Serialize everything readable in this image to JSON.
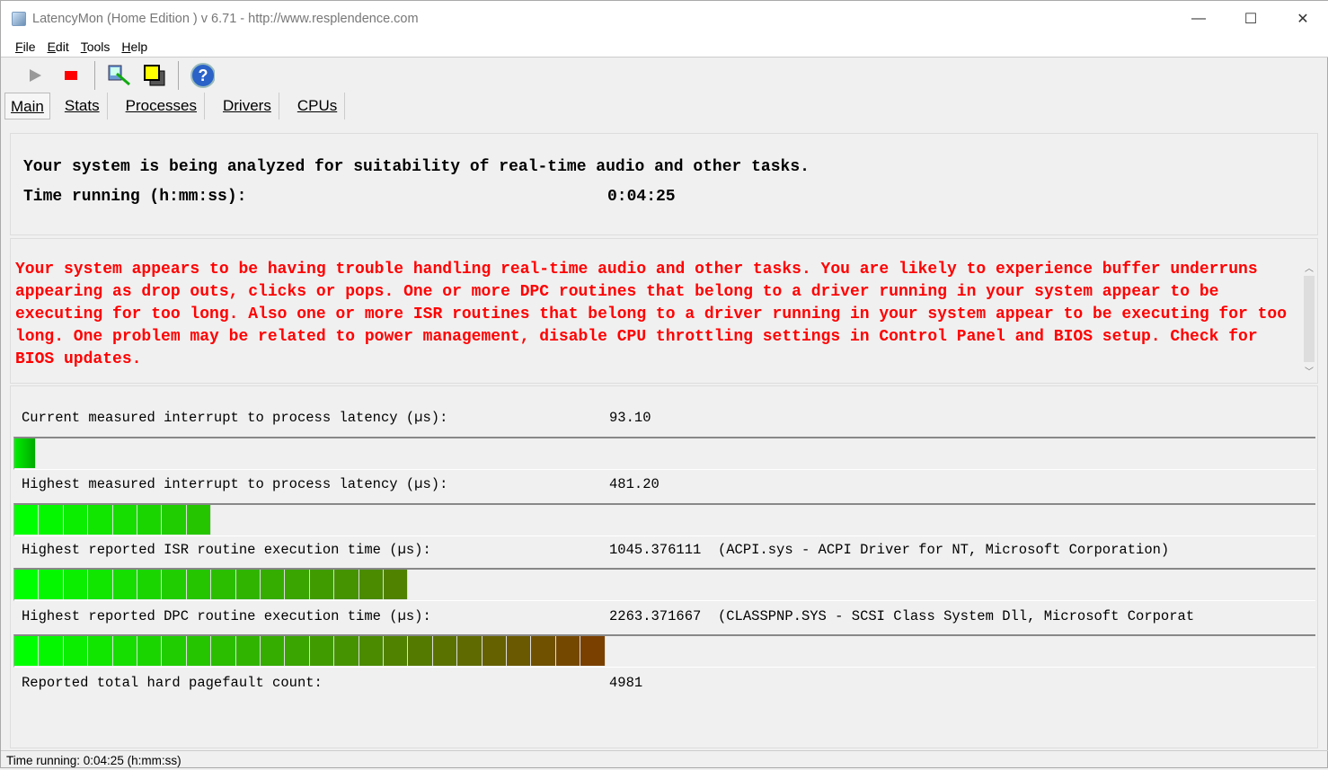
{
  "window": {
    "title": "LatencyMon  (Home Edition )  v 6.71 - http://www.resplendence.com",
    "minimize": "—",
    "maximize": "☐",
    "close": "✕"
  },
  "menu": [
    {
      "label": "File",
      "key": "F",
      "rest": "ile"
    },
    {
      "label": "Edit",
      "key": "E",
      "rest": "dit"
    },
    {
      "label": "Tools",
      "key": "T",
      "rest": "ools"
    },
    {
      "label": "Help",
      "key": "H",
      "rest": "elp"
    }
  ],
  "toolbar": {
    "icons": [
      "play-icon",
      "stop-icon",
      "driver-wizard-icon",
      "windows-icon",
      "help-icon"
    ],
    "help_glyph": "?"
  },
  "tabs": [
    "Main",
    "Stats",
    "Processes",
    "Drivers",
    "CPUs"
  ],
  "analysis": {
    "line1": "Your system is being analyzed for suitability of real-time audio and other tasks.",
    "time_label": "Time running (h:mm:ss):",
    "time_value": "0:04:25"
  },
  "verdict": {
    "text": "Your system appears to be having trouble handling real-time audio and other tasks. You are likely to experience buffer underruns appearing as drop outs, clicks or pops. One or more DPC routines that belong to a driver running in your system appear to be executing for too long. Also one or more ISR routines that belong to a driver running in your system appear to be executing for too long. One problem may be related to power management, disable CPU throttling settings in Control Panel and BIOS setup. Check for BIOS updates.",
    "color": "#ff0000"
  },
  "metrics": [
    {
      "label": "Current measured interrupt to process latency (µs):",
      "value": "93.10",
      "extra": "",
      "segments": 1
    },
    {
      "label": "Highest measured interrupt to process latency (µs):",
      "value": "481.20",
      "extra": "",
      "segments": 8
    },
    {
      "label": "Highest reported ISR routine execution time (µs):",
      "value": "1045.376111",
      "extra": "(ACPI.sys - ACPI Driver for NT, Microsoft Corporation)",
      "segments": 16
    },
    {
      "label": "Highest reported DPC routine execution time (µs):",
      "value": "2263.371667",
      "extra": "(CLASSPNP.SYS - SCSI Class System Dll, Microsoft Corporat",
      "segments": 24
    }
  ],
  "pagefault": {
    "label": "Reported total hard pagefault count:",
    "value": "4981"
  },
  "status": "Time running: 0:04:25  (h:mm:ss)",
  "colors": {
    "bar_start": "#00ff00",
    "bar_end": "#7a4000"
  }
}
